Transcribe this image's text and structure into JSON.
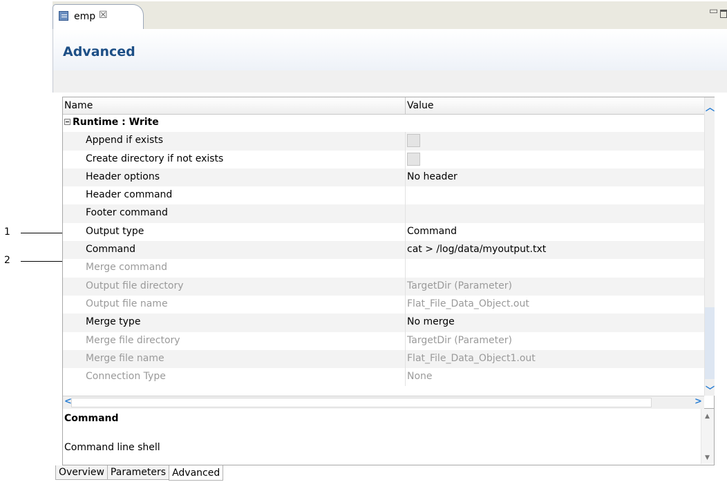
{
  "callouts": [
    "1",
    "2"
  ],
  "editor": {
    "tab_title": "emp",
    "tab_close": "☒",
    "minimize_glyph": "▭",
    "page_title": "Advanced"
  },
  "table": {
    "columns": [
      "Name",
      "Value"
    ],
    "category": "Runtime : Write",
    "rows": [
      {
        "name": "Append if exists",
        "value": "",
        "kind": "checkbox",
        "disabled": false
      },
      {
        "name": "Create directory if not exists",
        "value": "",
        "kind": "checkbox",
        "disabled": false
      },
      {
        "name": "Header options",
        "value": "No header",
        "kind": "text",
        "disabled": false
      },
      {
        "name": "Header command",
        "value": "",
        "kind": "text",
        "disabled": false
      },
      {
        "name": "Footer command",
        "value": "",
        "kind": "text",
        "disabled": false
      },
      {
        "name": "Output type",
        "value": "Command",
        "kind": "text",
        "disabled": false
      },
      {
        "name": "Command",
        "value": "cat > /log/data/myoutput.txt",
        "kind": "text",
        "disabled": false
      },
      {
        "name": "Merge command",
        "value": "",
        "kind": "text",
        "disabled": true
      },
      {
        "name": "Output file directory",
        "value": "TargetDir (Parameter)",
        "kind": "text",
        "disabled": true
      },
      {
        "name": "Output file name",
        "value": "Flat_File_Data_Object.out",
        "kind": "text",
        "disabled": true
      },
      {
        "name": "Merge type",
        "value": "No merge",
        "kind": "text",
        "disabled": false
      },
      {
        "name": "Merge file directory",
        "value": "TargetDir (Parameter)",
        "kind": "text",
        "disabled": true
      },
      {
        "name": "Merge file name",
        "value": "Flat_File_Data_Object1.out",
        "kind": "text",
        "disabled": true
      },
      {
        "name": "Connection Type",
        "value": "None",
        "kind": "text",
        "disabled": true
      }
    ]
  },
  "description": {
    "title": "Command",
    "text": "Command line shell"
  },
  "page_tabs": [
    {
      "label": "Overview",
      "active": false
    },
    {
      "label": "Parameters",
      "active": false
    },
    {
      "label": "Advanced",
      "active": true
    }
  ],
  "colors": {
    "title_blue": "#1d4f86",
    "scroll_arrow": "#2a7fd4",
    "disabled_text": "#9a9a9a"
  }
}
